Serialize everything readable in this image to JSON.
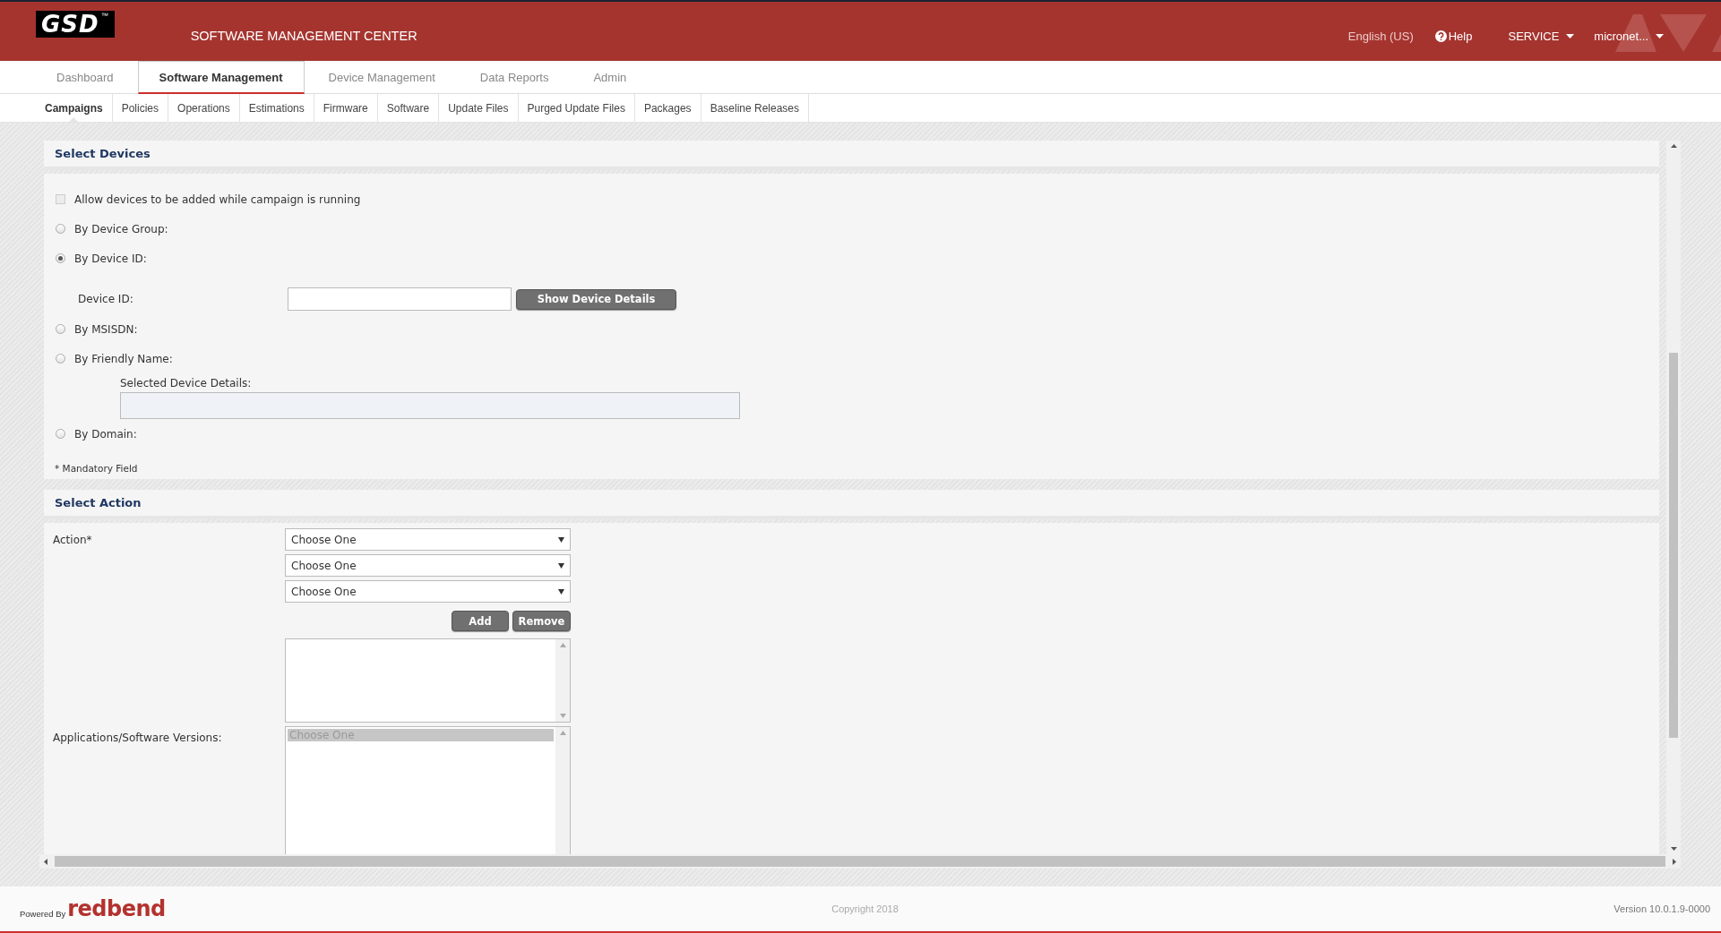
{
  "header": {
    "logo": "GSD",
    "logo_mark": "™",
    "title": "SOFTWARE MANAGEMENT CENTER",
    "language": "English (US)",
    "help": "Help",
    "role_menu": "SERVICE",
    "user_menu": "micronet..."
  },
  "main_tabs": [
    {
      "label": "Dashboard",
      "selected": false
    },
    {
      "label": "Software Management",
      "selected": true
    },
    {
      "label": "Device Management",
      "selected": false
    },
    {
      "label": "Data Reports",
      "selected": false
    },
    {
      "label": "Admin",
      "selected": false
    }
  ],
  "sub_tabs": [
    {
      "label": "Campaigns",
      "selected": true
    },
    {
      "label": "Policies",
      "selected": false
    },
    {
      "label": "Operations",
      "selected": false
    },
    {
      "label": "Estimations",
      "selected": false
    },
    {
      "label": "Firmware",
      "selected": false
    },
    {
      "label": "Software",
      "selected": false
    },
    {
      "label": "Update Files",
      "selected": false
    },
    {
      "label": "Purged Update Files",
      "selected": false
    },
    {
      "label": "Packages",
      "selected": false
    },
    {
      "label": "Baseline Releases",
      "selected": false
    }
  ],
  "select_devices": {
    "title": "Select Devices",
    "allow_added": {
      "label": "Allow devices to be added while campaign is running",
      "checked": false
    },
    "options": [
      {
        "kind": "radio",
        "label": "By Device Group:",
        "selected": false
      },
      {
        "kind": "radio",
        "label": "By Device ID:",
        "selected": true
      },
      {
        "kind": "id_field",
        "label": "Device ID:",
        "button": "Show Device Details"
      },
      {
        "kind": "radio",
        "label": "By MSISDN:",
        "selected": false
      },
      {
        "kind": "radio",
        "label": "By Friendly Name:",
        "selected": false
      },
      {
        "kind": "details",
        "label": "Selected Device Details:"
      },
      {
        "kind": "radio",
        "label": "By Domain:",
        "selected": false
      }
    ],
    "mandatory_note": "* Mandatory Field"
  },
  "select_action": {
    "title": "Select Action",
    "action_label": "Action*",
    "dropdowns": [
      {
        "value": "Choose One"
      },
      {
        "value": "Choose One"
      },
      {
        "value": "Choose One"
      }
    ],
    "buttons": [
      "Add",
      "Remove"
    ],
    "apps_label": "Applications/Software Versions:",
    "apps_list": [
      {
        "label": "Choose One",
        "selected": true
      }
    ]
  },
  "footer": {
    "powered_by": "Powered By",
    "brand": "redbend",
    "copyright": "Copyright 2018",
    "version": "Version 10.0.1.9-0000"
  }
}
